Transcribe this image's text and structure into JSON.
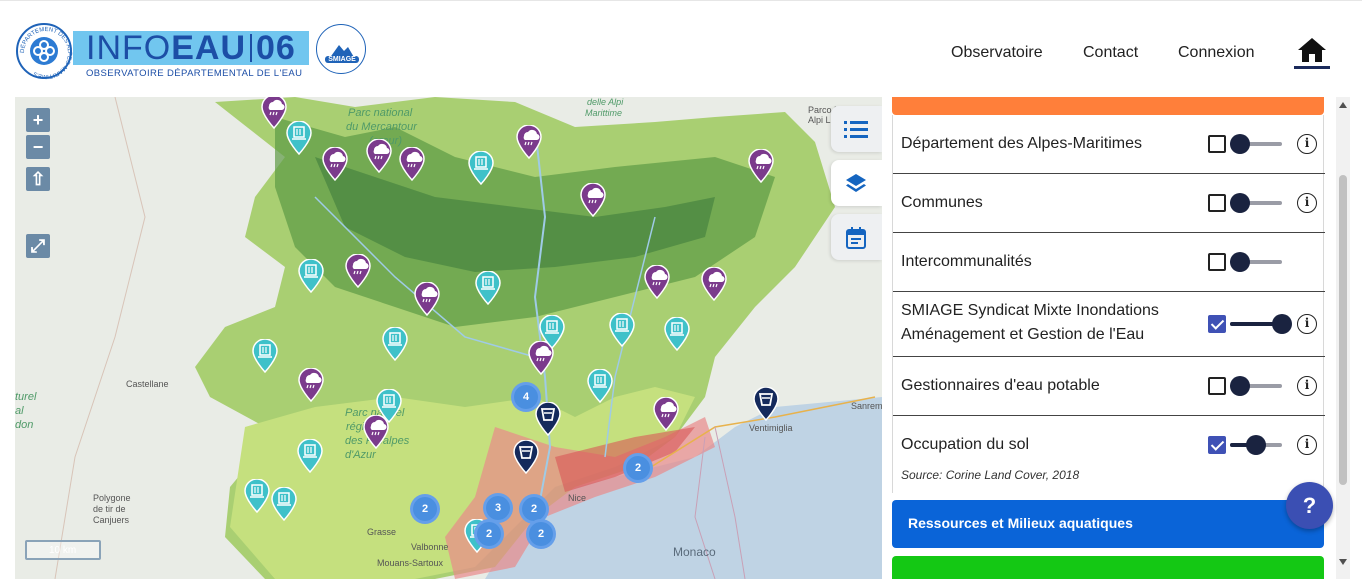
{
  "header": {
    "logo": {
      "title_light": "INFO",
      "title_bold": "EAU",
      "title_num": "06",
      "subtitle": "OBSERVATOIRE DÉPARTEMENTAL DE L'EAU",
      "emblem_text": "DÉPARTEMENT DES ALPES-MARITIMES",
      "partner_label": "SMIAGE"
    },
    "nav": [
      {
        "label": "Observatoire"
      },
      {
        "label": "Contact"
      },
      {
        "label": "Connexion"
      }
    ],
    "home_icon": "home-icon"
  },
  "map": {
    "controls": {
      "zoom_in": "+",
      "zoom_out": "−",
      "extent": "⇧",
      "fullscreen": "⤢"
    },
    "scale_label": "10 km",
    "places": [
      {
        "text": "Castellane"
      },
      {
        "text": "Ventimiglia"
      },
      {
        "text": "Sanrem"
      },
      {
        "text": "Monaco"
      },
      {
        "text": "Polygone"
      },
      {
        "text": "de tir de"
      },
      {
        "text": "Canjuers"
      },
      {
        "text": "Nice"
      },
      {
        "text": "Grasse"
      },
      {
        "text": "Valbonne"
      },
      {
        "text": "Mouans-Sartoux"
      },
      {
        "text": "Parco Naturale"
      },
      {
        "text": "Alpi Liguri"
      }
    ],
    "park_labels": [
      {
        "text": "Parc national"
      },
      {
        "text": "du Mercantour"
      },
      {
        "text": "(cœur)"
      },
      {
        "text": "delle Alpi"
      },
      {
        "text": "Marittime"
      },
      {
        "text": "turel"
      },
      {
        "text": "al"
      },
      {
        "text": "don"
      },
      {
        "text": "Parc naturel"
      },
      {
        "text": "régional"
      },
      {
        "text": "des Préalpes"
      },
      {
        "text": "d'Azur"
      }
    ],
    "clusters": [
      "4",
      "2",
      "2",
      "3",
      "2",
      "2",
      "2"
    ],
    "side_tabs": [
      {
        "icon": "list-icon"
      },
      {
        "icon": "layers-icon"
      },
      {
        "icon": "calendar-icon"
      }
    ]
  },
  "panel": {
    "layers": [
      {
        "name": "Département des Alpes-Maritimes",
        "checked": false,
        "opacity": 0,
        "info": true
      },
      {
        "name": "Communes",
        "checked": false,
        "opacity": 0,
        "info": true
      },
      {
        "name": "Intercommunalités",
        "checked": false,
        "opacity": 0,
        "info": false
      },
      {
        "name_line1": "SMIAGE Syndicat Mixte Inondations",
        "name_line2": "Aménagement et Gestion de l'Eau",
        "checked": true,
        "opacity": 1,
        "info": true
      },
      {
        "name": "Gestionnaires d'eau potable",
        "checked": false,
        "opacity": 0,
        "info": true
      },
      {
        "name": "Occupation du sol",
        "checked": true,
        "opacity": 0.5,
        "info": true,
        "source": "Source: Corine Land Cover, 2018"
      }
    ],
    "info_glyph": "i",
    "sections": [
      {
        "label": "Ressources et Milieux aquatiques",
        "color": "#0a64d8"
      },
      {
        "label": "",
        "color": "#14c814"
      }
    ],
    "help_label": "?"
  },
  "colors": {
    "accent_orange": "#ff7f3a",
    "navy": "#1a2340",
    "checkbox": "#3f51b5",
    "pin_purple": "#7b3b8c",
    "pin_teal": "#3fc1c9",
    "pin_navy": "#152a5c",
    "cluster_blue": "#4a8fe0"
  }
}
